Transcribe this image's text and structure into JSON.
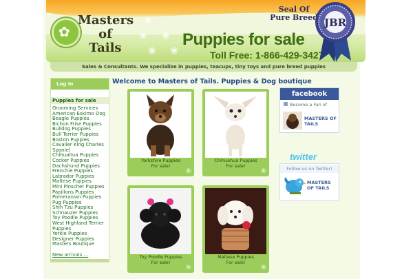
{
  "header": {
    "brand_line1": "Masters",
    "brand_line2": "of",
    "brand_line3": "Tails",
    "title": "Puppies for sale",
    "tollfree": "Toll Free: 1-866-429-3427",
    "seal_line1": "Seal Of",
    "seal_line2": "Pure Breed",
    "seal_initials": "JBR"
  },
  "tagline": "Sales & Consultants. We specialize in puppies, teacups, tiny toys and pure breed puppies",
  "sidebar": {
    "login_label": "Log In",
    "category_heading": "Puppies for sale",
    "items": [
      "Grooming Services",
      "American Eskimo Dog",
      "Beagle Puppies",
      "Bichon Frise Puppies",
      "Bulldog Puppies",
      "Bull Terrier Puppies",
      "Boston Puppies",
      "Cavalier King Charles",
      "Spaniel",
      "Chihuahua Puppies",
      "Cocker Puppies",
      "Dachshund Puppies",
      "Frenchie Puppies",
      "Labrador Puppies",
      "Maltese Puppies",
      "Mini Pinscher Puppies",
      "Papillons Puppies",
      "Pomeranian Puppies",
      "Pug Puppies",
      "Shih Tzu Puppies",
      "Schnauzer Puppies",
      "Toy Poodle Puppies",
      "West Highland Terrier",
      "Puppies",
      "Yorkie Puppies",
      "Designer Puppies",
      "Masters Boutique"
    ],
    "new_arrivals": "New arrivals ..."
  },
  "main": {
    "welcome": "Welcome to Masters of Tails. Puppies & Dog boutique",
    "cards": [
      {
        "title": "Yorkshire Puppies",
        "sub": "For sale!"
      },
      {
        "title": "Chihuahua Puppies",
        "sub": "For sale!"
      },
      {
        "title": "Toy Poodle Puppies",
        "sub": "For sale!"
      },
      {
        "title": "Maltese Puppies",
        "sub": "For sale!"
      }
    ]
  },
  "facebook": {
    "logo": "facebook",
    "fan_text": "Become a Fan of",
    "name_line1": "MASTERS OF",
    "name_line2": "TAILS"
  },
  "twitter": {
    "logo": "twitter",
    "follow_text": "Follow us on Twitter!",
    "name_line1": "MASTERS",
    "name_line2": "OF TAILS"
  },
  "colors": {
    "accent_green": "#9ccc5a",
    "title_green": "#3e6d12",
    "link_green": "#1f6f1f",
    "welcome_blue": "#1f4a86",
    "facebook_blue": "#3b5998"
  }
}
